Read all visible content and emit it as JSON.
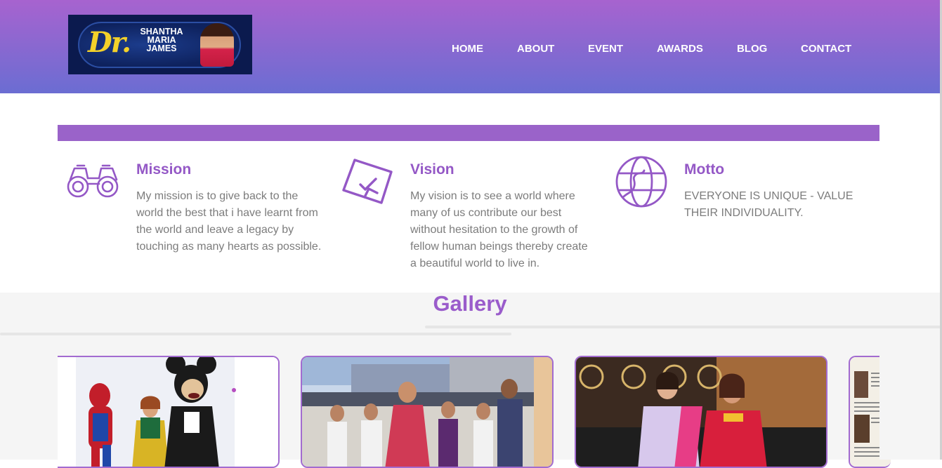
{
  "logo": {
    "dr": "Dr.",
    "name_line1": "SHANTHA",
    "name_line2": "MARIA",
    "name_line3": "JAMES"
  },
  "nav": {
    "items": [
      {
        "label": "HOME"
      },
      {
        "label": "ABOUT"
      },
      {
        "label": "EVENT"
      },
      {
        "label": "AWARDS"
      },
      {
        "label": "BLOG"
      },
      {
        "label": "CONTACT"
      }
    ]
  },
  "features": [
    {
      "title": "Mission",
      "icon": "binoculars-icon",
      "text": "My mission is to give back to the world the best that i have learnt from the world and leave a legacy by touching as many hearts as possible."
    },
    {
      "title": "Vision",
      "icon": "checklist-icon",
      "text": "My vision is to see a world where many of us contribute our best without hesitation to the growth of fellow human beings thereby create a beautiful world to live in."
    },
    {
      "title": "Motto",
      "icon": "globe-icon",
      "text": "EVERYONE IS UNIQUE - VALUE THEIR INDIVIDUALITY."
    }
  ],
  "gallery": {
    "title": "Gallery",
    "items": [
      {
        "name": "gallery-photo-costume-characters"
      },
      {
        "name": "gallery-photo-school-students"
      },
      {
        "name": "gallery-photo-two-women"
      },
      {
        "name": "gallery-photo-newspaper-clipping"
      }
    ]
  },
  "colors": {
    "header_top": "#a763cf",
    "header_bottom": "#6b6dd2",
    "accent": "#9458c6",
    "body_text": "#7c7c7c"
  }
}
